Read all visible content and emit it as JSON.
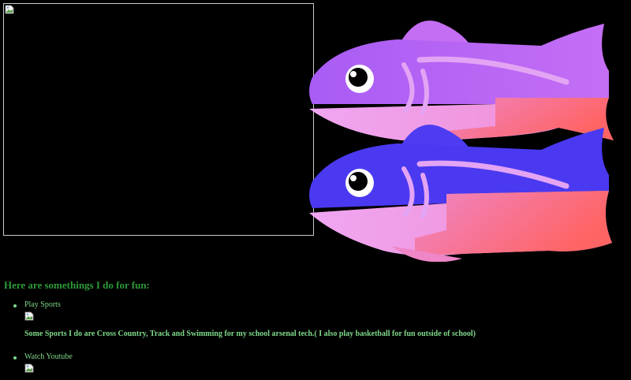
{
  "colors": {
    "background": "#000000",
    "heading": "#2e9a3a",
    "list_text": "#7fd98a",
    "frame_border": "#c9c9c9",
    "fish_top_purple": "#b565f2",
    "fish_bottom_blue": "#4a39f0",
    "fish_belly_pink": "#ec9cf0",
    "fish_tail_coral": "#ff6a6a",
    "fish_fin_lilac": "#e3a4f4"
  },
  "images": {
    "main_image": {
      "state": "broken",
      "icon": "broken-image-icon"
    },
    "fish_logo": {
      "icon": "fish-logo",
      "count": 2
    }
  },
  "content": {
    "heading": "Here are somethings I do for fun:",
    "activities": [
      {
        "label": "Play Sports",
        "image": "broken-image-icon",
        "note": "Some Sports I do are Cross Country, Track and Swimming for my school arsenal tech.( I also play basketball for fun outside of school)"
      },
      {
        "label": "Watch Youtube",
        "image": "broken-image-icon"
      }
    ]
  }
}
